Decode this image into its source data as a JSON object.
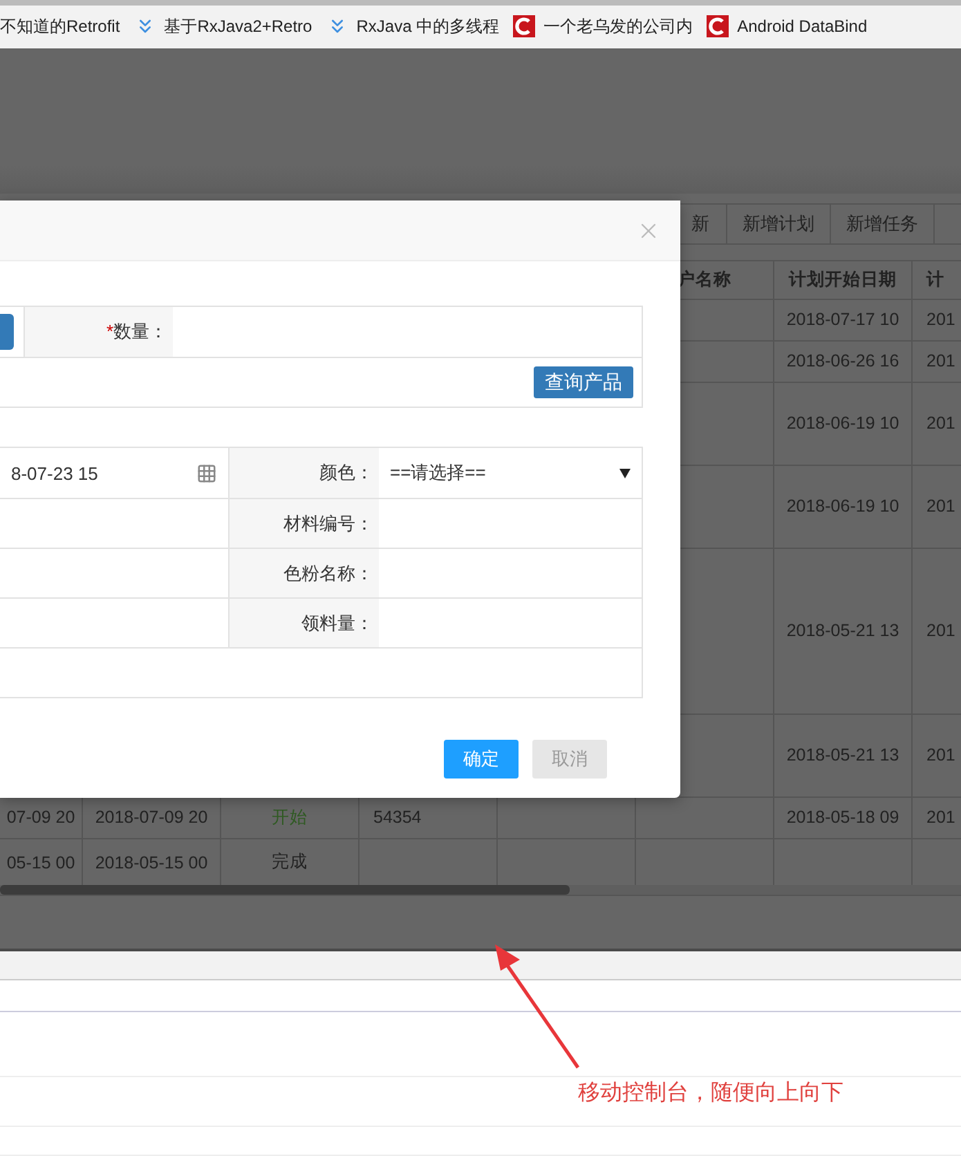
{
  "bookmarks": [
    {
      "title": "不知道的Retrofit",
      "kind": "plain"
    },
    {
      "title": "基于RxJava2+Retro",
      "kind": "chevron"
    },
    {
      "title": "RxJava 中的多线程",
      "kind": "chevron"
    },
    {
      "title": "一个老乌发的公司内",
      "kind": "logo"
    },
    {
      "title": "Android DataBind",
      "kind": "logo"
    }
  ],
  "toolbar": {
    "buttons": [
      "新",
      "新增计划",
      "新增任务"
    ]
  },
  "table": {
    "headers": {
      "customer_name": "户名称",
      "plan_start_date": "计划开始日期",
      "column_8": "计"
    },
    "rows": [
      {
        "plan_start_date": "2018-07-17 10",
        "column_8": "201"
      },
      {
        "plan_start_date": "2018-06-26 16",
        "column_8": "201"
      },
      {
        "plan_start_date": "2018-06-19 10",
        "column_8": "201"
      },
      {
        "plan_start_date": "2018-06-19 10",
        "column_8": "201"
      },
      {
        "plan_start_date": "2018-05-21 13",
        "column_8": "201"
      },
      {
        "plan_start_date": "2018-05-21 13",
        "column_8": "201"
      },
      {
        "column_1": "07-09 20",
        "column_2": "2018-07-09 20",
        "status": "开始",
        "color": "#2f5a22",
        "column_4": "54354",
        "plan_start_date": "2018-05-18 09",
        "column_8": "201"
      },
      {
        "column_1": "05-15 00",
        "column_2": "2018-05-15 00",
        "status": "完成",
        "color": "#222222"
      }
    ]
  },
  "dialog": {
    "quantity": {
      "mark": "*",
      "label": "数量："
    },
    "query_button": "查询产品",
    "date_value": "8-07-23 15",
    "fields": [
      {
        "label": "颜色：",
        "kind": "select",
        "value": "==请选择=="
      },
      {
        "label": "材料编号：",
        "kind": "text"
      },
      {
        "label": "色粉名称：",
        "kind": "text"
      },
      {
        "label": "领料量：",
        "kind": "text"
      }
    ],
    "confirm": "确定",
    "cancel": "取消"
  },
  "annotation": "移动控制台，随便向上向下"
}
